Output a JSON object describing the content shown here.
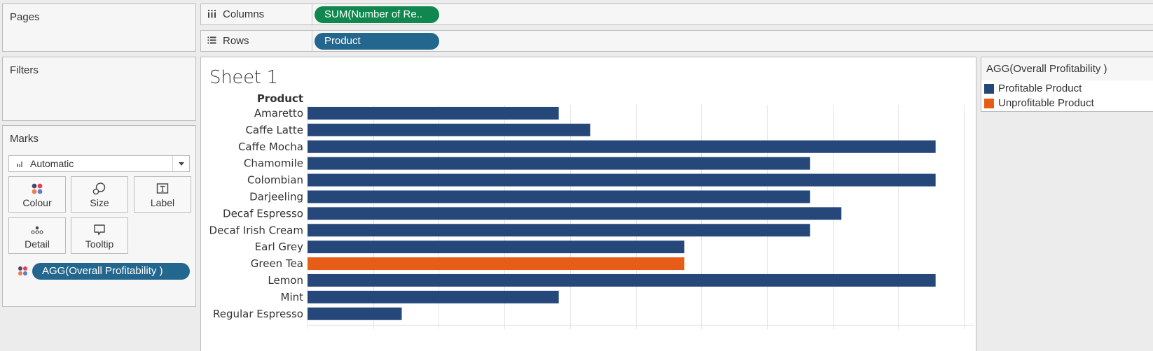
{
  "cards": {
    "pages_title": "Pages",
    "filters_title": "Filters",
    "marks_title": "Marks"
  },
  "marks": {
    "type": "Automatic",
    "buttons": [
      {
        "label": "Colour",
        "icon": "colour-icon"
      },
      {
        "label": "Size",
        "icon": "size-icon"
      },
      {
        "label": "Label",
        "icon": "label-icon"
      },
      {
        "label": "Detail",
        "icon": "detail-icon"
      },
      {
        "label": "Tooltip",
        "icon": "tooltip-icon"
      }
    ],
    "pill": "AGG(Overall Profitability )"
  },
  "shelves": {
    "columns_label": "Columns",
    "columns_pill": "SUM(Number of Re..",
    "rows_label": "Rows",
    "rows_pill": "Product"
  },
  "sheet": {
    "title": "Sheet 1"
  },
  "legend": {
    "title": "AGG(Overall Profitability )",
    "items": [
      {
        "label": "Profitable Product",
        "color": "#26477a"
      },
      {
        "label": "Unprofitable Product",
        "color": "#e75c17"
      }
    ]
  },
  "colors": {
    "columns_pill": "#10874f",
    "rows_pill": "#23678e",
    "profitable": "#26477a",
    "unprofitable": "#e75c17"
  },
  "chart_data": {
    "type": "bar",
    "orientation": "horizontal",
    "title": "Sheet 1",
    "row_header": "Product",
    "xlabel": "SUM(Number of Re..",
    "ylabel": "Product",
    "axis_labels_shown": false,
    "grid": true,
    "legend_position": "right",
    "xlim": [
      0,
      20.9
    ],
    "x_grid_step": 2.09,
    "categories": [
      "Amaretto",
      "Caffe Latte",
      "Caffe Mocha",
      "Chamomile",
      "Colombian",
      "Darjeeling",
      "Decaf Espresso",
      "Decaf Irish Cream",
      "Earl Grey",
      "Green Tea",
      "Lemon",
      "Mint",
      "Regular Espresso"
    ],
    "values": [
      8,
      9,
      20,
      16,
      20,
      16,
      17,
      16,
      12,
      12,
      20,
      8,
      3
    ],
    "color_field": "AGG(Overall Profitability )",
    "color_values": [
      "Profitable Product",
      "Profitable Product",
      "Profitable Product",
      "Profitable Product",
      "Profitable Product",
      "Profitable Product",
      "Profitable Product",
      "Profitable Product",
      "Profitable Product",
      "Unprofitable Product",
      "Profitable Product",
      "Profitable Product",
      "Profitable Product"
    ]
  }
}
